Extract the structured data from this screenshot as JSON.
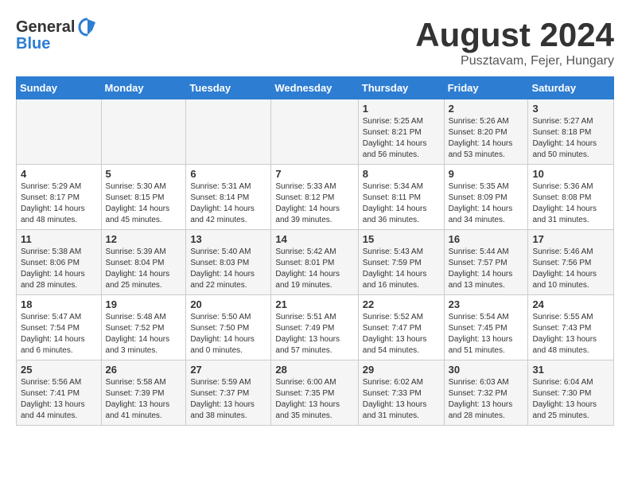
{
  "header": {
    "logo_general": "General",
    "logo_blue": "Blue",
    "month_title": "August 2024",
    "location": "Pusztavam, Fejer, Hungary"
  },
  "weekdays": [
    "Sunday",
    "Monday",
    "Tuesday",
    "Wednesday",
    "Thursday",
    "Friday",
    "Saturday"
  ],
  "weeks": [
    [
      {
        "day": "",
        "info": ""
      },
      {
        "day": "",
        "info": ""
      },
      {
        "day": "",
        "info": ""
      },
      {
        "day": "",
        "info": ""
      },
      {
        "day": "1",
        "info": "Sunrise: 5:25 AM\nSunset: 8:21 PM\nDaylight: 14 hours\nand 56 minutes."
      },
      {
        "day": "2",
        "info": "Sunrise: 5:26 AM\nSunset: 8:20 PM\nDaylight: 14 hours\nand 53 minutes."
      },
      {
        "day": "3",
        "info": "Sunrise: 5:27 AM\nSunset: 8:18 PM\nDaylight: 14 hours\nand 50 minutes."
      }
    ],
    [
      {
        "day": "4",
        "info": "Sunrise: 5:29 AM\nSunset: 8:17 PM\nDaylight: 14 hours\nand 48 minutes."
      },
      {
        "day": "5",
        "info": "Sunrise: 5:30 AM\nSunset: 8:15 PM\nDaylight: 14 hours\nand 45 minutes."
      },
      {
        "day": "6",
        "info": "Sunrise: 5:31 AM\nSunset: 8:14 PM\nDaylight: 14 hours\nand 42 minutes."
      },
      {
        "day": "7",
        "info": "Sunrise: 5:33 AM\nSunset: 8:12 PM\nDaylight: 14 hours\nand 39 minutes."
      },
      {
        "day": "8",
        "info": "Sunrise: 5:34 AM\nSunset: 8:11 PM\nDaylight: 14 hours\nand 36 minutes."
      },
      {
        "day": "9",
        "info": "Sunrise: 5:35 AM\nSunset: 8:09 PM\nDaylight: 14 hours\nand 34 minutes."
      },
      {
        "day": "10",
        "info": "Sunrise: 5:36 AM\nSunset: 8:08 PM\nDaylight: 14 hours\nand 31 minutes."
      }
    ],
    [
      {
        "day": "11",
        "info": "Sunrise: 5:38 AM\nSunset: 8:06 PM\nDaylight: 14 hours\nand 28 minutes."
      },
      {
        "day": "12",
        "info": "Sunrise: 5:39 AM\nSunset: 8:04 PM\nDaylight: 14 hours\nand 25 minutes."
      },
      {
        "day": "13",
        "info": "Sunrise: 5:40 AM\nSunset: 8:03 PM\nDaylight: 14 hours\nand 22 minutes."
      },
      {
        "day": "14",
        "info": "Sunrise: 5:42 AM\nSunset: 8:01 PM\nDaylight: 14 hours\nand 19 minutes."
      },
      {
        "day": "15",
        "info": "Sunrise: 5:43 AM\nSunset: 7:59 PM\nDaylight: 14 hours\nand 16 minutes."
      },
      {
        "day": "16",
        "info": "Sunrise: 5:44 AM\nSunset: 7:57 PM\nDaylight: 14 hours\nand 13 minutes."
      },
      {
        "day": "17",
        "info": "Sunrise: 5:46 AM\nSunset: 7:56 PM\nDaylight: 14 hours\nand 10 minutes."
      }
    ],
    [
      {
        "day": "18",
        "info": "Sunrise: 5:47 AM\nSunset: 7:54 PM\nDaylight: 14 hours\nand 6 minutes."
      },
      {
        "day": "19",
        "info": "Sunrise: 5:48 AM\nSunset: 7:52 PM\nDaylight: 14 hours\nand 3 minutes."
      },
      {
        "day": "20",
        "info": "Sunrise: 5:50 AM\nSunset: 7:50 PM\nDaylight: 14 hours\nand 0 minutes."
      },
      {
        "day": "21",
        "info": "Sunrise: 5:51 AM\nSunset: 7:49 PM\nDaylight: 13 hours\nand 57 minutes."
      },
      {
        "day": "22",
        "info": "Sunrise: 5:52 AM\nSunset: 7:47 PM\nDaylight: 13 hours\nand 54 minutes."
      },
      {
        "day": "23",
        "info": "Sunrise: 5:54 AM\nSunset: 7:45 PM\nDaylight: 13 hours\nand 51 minutes."
      },
      {
        "day": "24",
        "info": "Sunrise: 5:55 AM\nSunset: 7:43 PM\nDaylight: 13 hours\nand 48 minutes."
      }
    ],
    [
      {
        "day": "25",
        "info": "Sunrise: 5:56 AM\nSunset: 7:41 PM\nDaylight: 13 hours\nand 44 minutes."
      },
      {
        "day": "26",
        "info": "Sunrise: 5:58 AM\nSunset: 7:39 PM\nDaylight: 13 hours\nand 41 minutes."
      },
      {
        "day": "27",
        "info": "Sunrise: 5:59 AM\nSunset: 7:37 PM\nDaylight: 13 hours\nand 38 minutes."
      },
      {
        "day": "28",
        "info": "Sunrise: 6:00 AM\nSunset: 7:35 PM\nDaylight: 13 hours\nand 35 minutes."
      },
      {
        "day": "29",
        "info": "Sunrise: 6:02 AM\nSunset: 7:33 PM\nDaylight: 13 hours\nand 31 minutes."
      },
      {
        "day": "30",
        "info": "Sunrise: 6:03 AM\nSunset: 7:32 PM\nDaylight: 13 hours\nand 28 minutes."
      },
      {
        "day": "31",
        "info": "Sunrise: 6:04 AM\nSunset: 7:30 PM\nDaylight: 13 hours\nand 25 minutes."
      }
    ]
  ]
}
